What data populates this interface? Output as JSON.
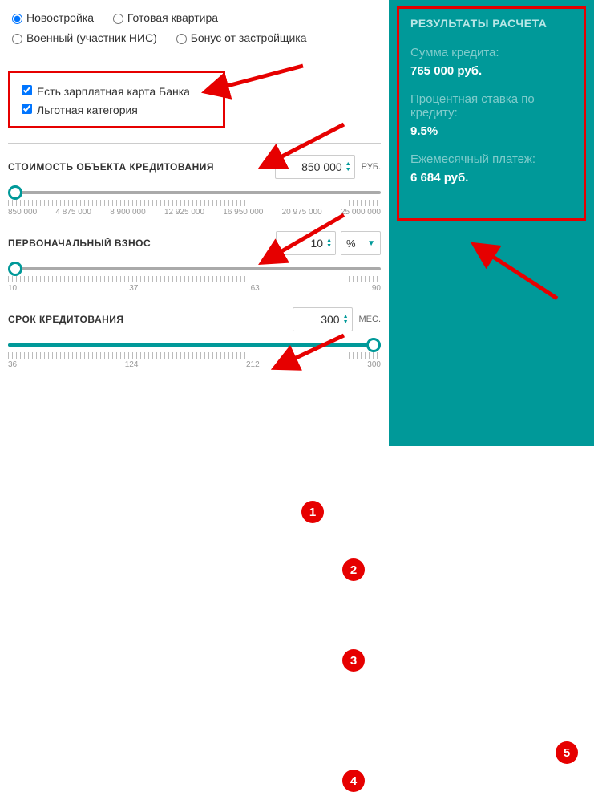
{
  "radios": {
    "r1": "Новостройка",
    "r2": "Готовая квартира",
    "r3": "Военный (участник НИС)",
    "r4": "Бонус от застройщика"
  },
  "checkboxes": {
    "salary_card": "Есть зарплатная карта Банка",
    "preferential": "Льготная категория"
  },
  "fields": {
    "cost": {
      "label": "СТОИМОСТЬ ОБЪЕКТА КРЕДИТОВАНИЯ",
      "value": "850 000",
      "unit": "РУБ.",
      "ticks": [
        "850 000",
        "4 875 000",
        "8 900 000",
        "12 925 000",
        "16 950 000",
        "20 975 000",
        "25 000 000"
      ]
    },
    "down": {
      "label": "ПЕРВОНАЧАЛЬНЫЙ ВЗНОС",
      "value": "10",
      "unit_select": "%",
      "ticks": [
        "10",
        "37",
        "63",
        "90"
      ]
    },
    "term": {
      "label": "СРОК КРЕДИТОВАНИЯ",
      "value": "300",
      "unit": "МЕС.",
      "ticks": [
        "36",
        "124",
        "212",
        "300"
      ]
    }
  },
  "results": {
    "title": "РЕЗУЛЬТАТЫ РАСЧЕТА",
    "loan_label": "Сумма кредита:",
    "loan_value": "765 000 руб.",
    "rate_label": "Процентная ставка по кредиту:",
    "rate_value": "9.5%",
    "payment_label": "Ежемесячный платеж:",
    "payment_value": "6 684 руб."
  },
  "annotations": {
    "a1": "1",
    "a2": "2",
    "a3": "3",
    "a4": "4",
    "a5": "5"
  }
}
